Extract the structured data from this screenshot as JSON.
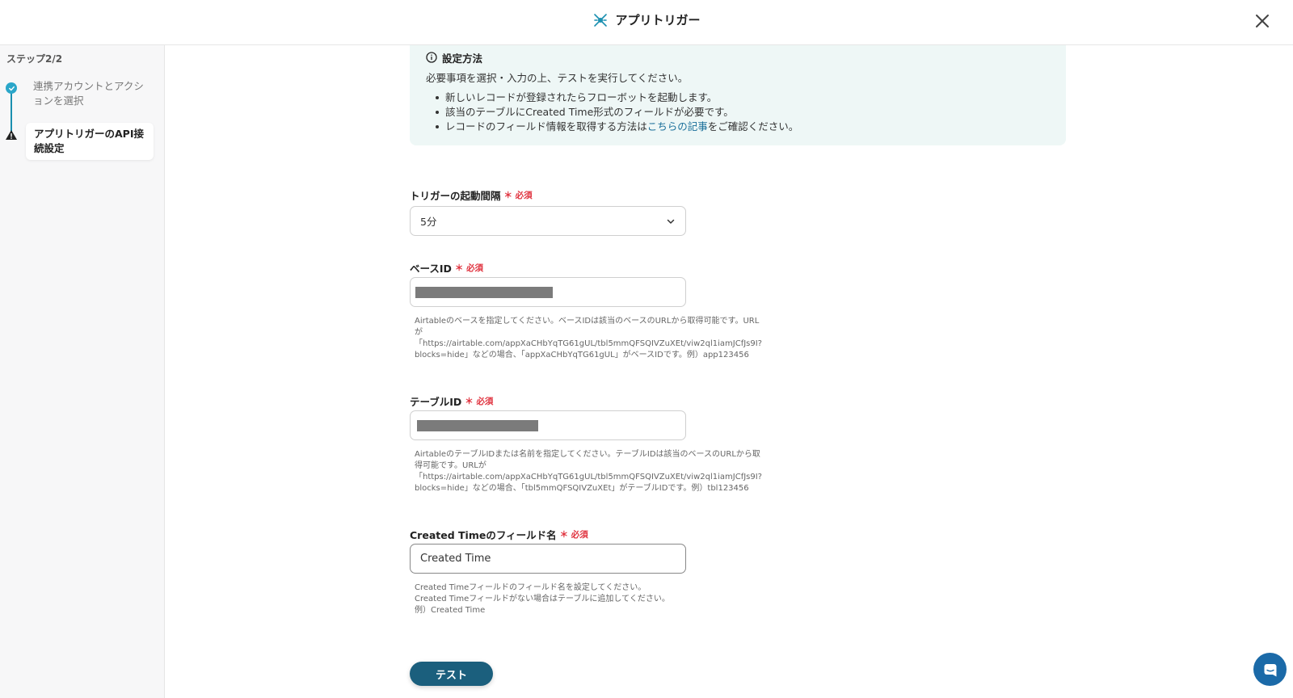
{
  "header": {
    "title": "アプリトリガー"
  },
  "sidebar": {
    "step_label": "ステップ2/2",
    "step1": "連携アカウントとアクションを選択",
    "step2": "アプリトリガーのAPI接続設定"
  },
  "info": {
    "title": "設定方法",
    "desc": "必要事項を選択・入力の上、テストを実行してください。",
    "bullet1": "新しいレコードが登録されたらフローボットを起動します。",
    "bullet2": "該当のテーブルにCreated Time形式のフィールドが必要です。",
    "bullet3_pre": "レコードのフィールド情報を取得する方法は",
    "bullet3_link": "こちらの記事",
    "bullet3_post": "をご確認ください。"
  },
  "fields": {
    "interval": {
      "label": "トリガーの起動間隔",
      "required": "必須",
      "value": "5分"
    },
    "base_id": {
      "label": "ベースID",
      "required": "必須",
      "help": "Airtableのベースを指定してください。ベースIDは該当のベースのURLから取得可能です。URLが「https://airtable.com/appXaCHbYqTG61gUL/tbl5mmQFSQIVZuXEt/viw2ql1iamJCfJs9I?blocks=hide」などの場合、「appXaCHbYqTG61gUL」がベースIDです。例）app123456"
    },
    "table_id": {
      "label": "テーブルID",
      "required": "必須",
      "help": "AirtableのテーブルIDまたは名前を指定してください。テーブルIDは該当のベースのURLから取得可能です。URLが「https://airtable.com/appXaCHbYqTG61gUL/tbl5mmQFSQIVZuXEt/viw2ql1iamJCfJs9I?blocks=hide」などの場合、「tbl5mmQFSQIVZuXEt」がテーブルIDです。例）tbl123456"
    },
    "created_time": {
      "label": "Created Timeのフィールド名",
      "required": "必須",
      "value": "Created Time",
      "help": "Created Timeフィールドのフィールド名を設定してください。Created Timeフィールドがない場合はテーブルに追加してください。例）Created Time"
    }
  },
  "buttons": {
    "test": "テスト"
  },
  "colors": {
    "accent": "#1b5f7d",
    "required": "#e0333f",
    "info_bg": "#eef7f6"
  }
}
